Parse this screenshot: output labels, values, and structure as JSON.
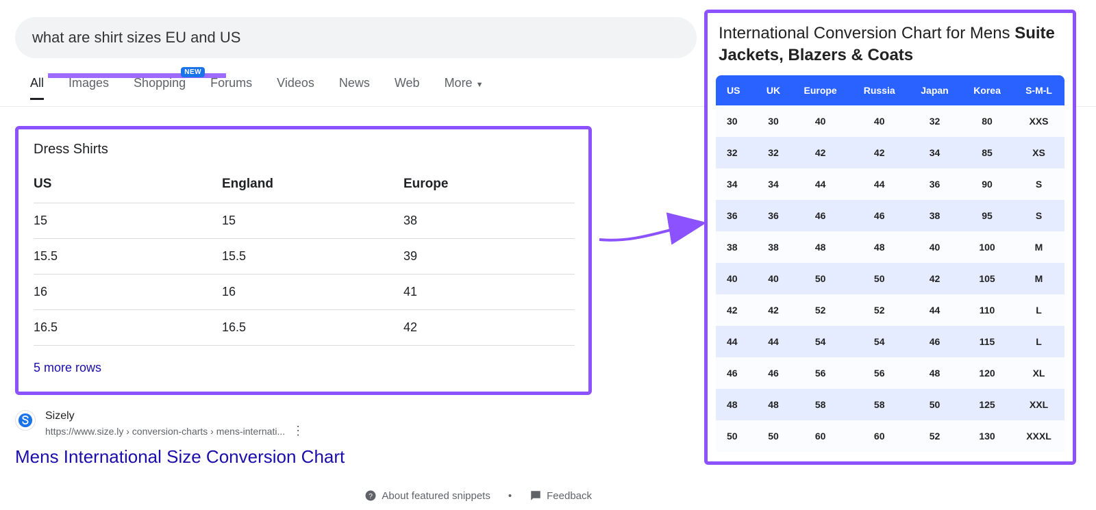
{
  "search": {
    "query": "what are shirt sizes EU and US"
  },
  "tabs": {
    "items": [
      "All",
      "Images",
      "Shopping",
      "Forums",
      "Videos",
      "News",
      "Web",
      "More"
    ],
    "badge": "NEW"
  },
  "snippet": {
    "heading": "Dress Shirts",
    "columns": [
      "US",
      "England",
      "Europe"
    ],
    "rows": [
      [
        "15",
        "15",
        "38"
      ],
      [
        "15.5",
        "15.5",
        "39"
      ],
      [
        "16",
        "16",
        "41"
      ],
      [
        "16.5",
        "16.5",
        "42"
      ]
    ],
    "more_rows_label": "5 more rows"
  },
  "result": {
    "site": "Sizely",
    "breadcrumb": "https://www.size.ly › conversion-charts › mens-internati...",
    "title": "Mens International Size Conversion Chart"
  },
  "footer": {
    "about": "About featured snippets",
    "feedback": "Feedback"
  },
  "chart_title": {
    "plain": "International Conversion Chart for Mens ",
    "bold": "Suite Jackets, Blazers & Coats"
  },
  "chart_data": {
    "type": "table",
    "title": "International Conversion Chart for Mens Suite Jackets, Blazers & Coats",
    "columns": [
      "US",
      "UK",
      "Europe",
      "Russia",
      "Japan",
      "Korea",
      "S-M-L"
    ],
    "rows": [
      [
        "30",
        "30",
        "40",
        "40",
        "32",
        "80",
        "XXS"
      ],
      [
        "32",
        "32",
        "42",
        "42",
        "34",
        "85",
        "XS"
      ],
      [
        "34",
        "34",
        "44",
        "44",
        "36",
        "90",
        "S"
      ],
      [
        "36",
        "36",
        "46",
        "46",
        "38",
        "95",
        "S"
      ],
      [
        "38",
        "38",
        "48",
        "48",
        "40",
        "100",
        "M"
      ],
      [
        "40",
        "40",
        "50",
        "50",
        "42",
        "105",
        "M"
      ],
      [
        "42",
        "42",
        "52",
        "52",
        "44",
        "110",
        "L"
      ],
      [
        "44",
        "44",
        "54",
        "54",
        "46",
        "115",
        "L"
      ],
      [
        "46",
        "46",
        "56",
        "56",
        "48",
        "120",
        "XL"
      ],
      [
        "48",
        "48",
        "58",
        "58",
        "50",
        "125",
        "XXL"
      ],
      [
        "50",
        "50",
        "60",
        "60",
        "52",
        "130",
        "XXXL"
      ]
    ]
  }
}
